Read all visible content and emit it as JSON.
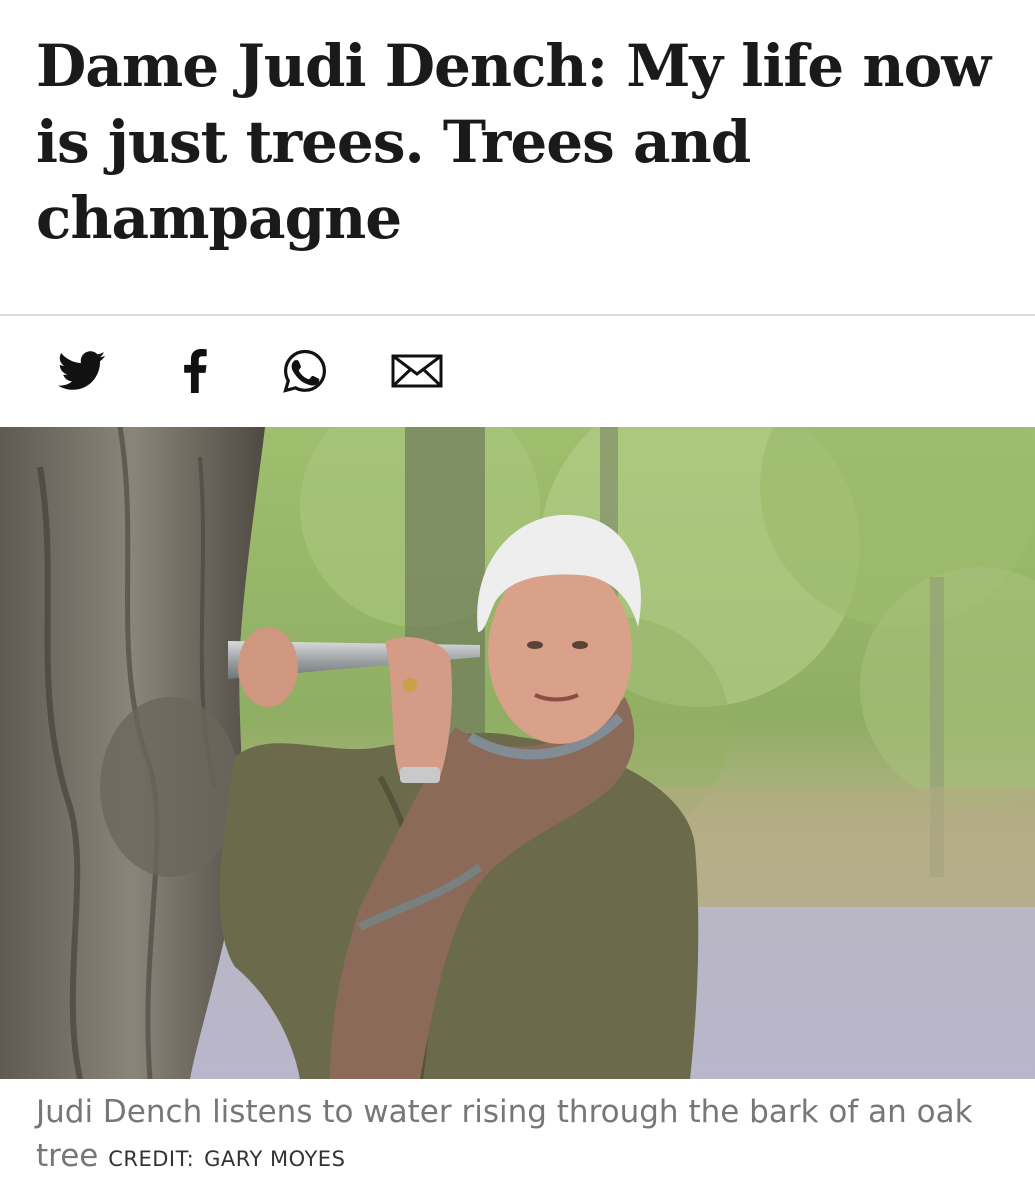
{
  "article": {
    "headline": "Dame Judi Dench: My life now is just trees. Trees and champagne"
  },
  "share": {
    "icons": [
      "twitter-icon",
      "facebook-icon",
      "whatsapp-icon",
      "email-icon"
    ]
  },
  "photo": {
    "caption": "Judi Dench listens to water rising through the bark of an oak tree",
    "credit_label": "CREDIT:",
    "credit_name": "GARY MOYES"
  },
  "colors": {
    "headline": "#1a1a1a",
    "caption": "#777777",
    "credit": "#333333",
    "divider": "#dddddd"
  }
}
